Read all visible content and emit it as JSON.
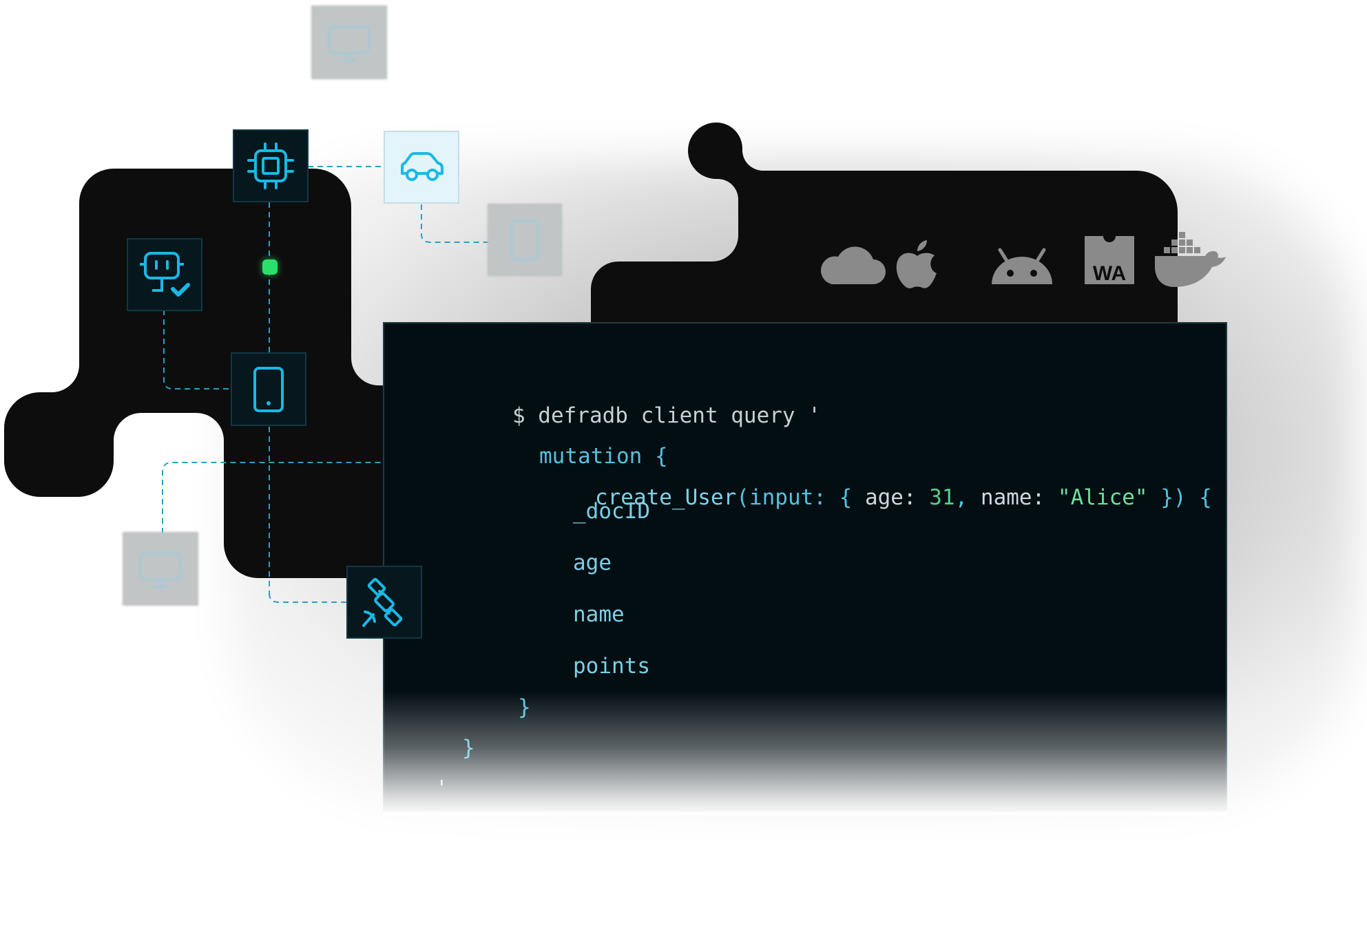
{
  "terminal": {
    "command": "$ defradb client query '",
    "mutation_keyword": "mutation",
    "mutation_brace": " {",
    "create_fn": "create_User",
    "args_open": "(input: { ",
    "arg_age_key": "age:",
    "arg_age_value": " 31",
    "arg_sep": ", ",
    "arg_name_key": "name:",
    "arg_name_value": " \"Alice\"",
    "args_close": " }) {",
    "fields": [
      "_docID",
      "age",
      "name",
      "points"
    ],
    "close_inner": "}",
    "close_outer": "}",
    "close_quote": "'"
  },
  "platforms": {
    "icons": [
      "cloud-icon",
      "apple-icon",
      "android-icon",
      "webassembly-icon",
      "docker-icon"
    ],
    "webassembly_label": "WA"
  },
  "devices": {
    "icons": [
      "chip-icon",
      "car-icon",
      "tablet-icon",
      "robot-icon",
      "monitor-icon",
      "satellite-icon"
    ]
  },
  "colors": {
    "background": "#ffffff",
    "panel": "#0d0d0d",
    "terminal_bg": "#030e13",
    "accent_cyan": "#1ab8e6",
    "accent_green": "#2ae06a",
    "platform_icon_gray": "#8a8a8a"
  }
}
